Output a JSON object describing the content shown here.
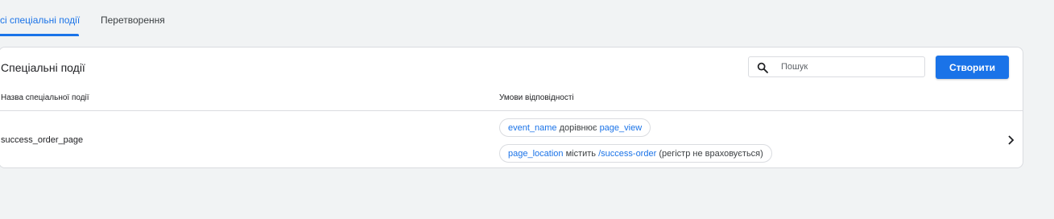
{
  "tabs": [
    {
      "label": "сі спеціальні події",
      "active": true
    },
    {
      "label": "Перетворення",
      "active": false
    }
  ],
  "card": {
    "title": "Спеціальні події",
    "search": {
      "placeholder": "Пошук",
      "icon": "search-icon"
    },
    "create_button": "Створити"
  },
  "table": {
    "columns": [
      "Назва спеціальної події",
      "Умови відповідності"
    ],
    "rows": [
      {
        "name": "success_order_page",
        "conditions": [
          {
            "param": "event_name",
            "operator": "дорівнює",
            "value": "page_view",
            "note": ""
          },
          {
            "param": "page_location",
            "operator": "містить",
            "value": "/success-order",
            "note": "(регістр не враховується)"
          }
        ],
        "action_icon": "chevron-right-icon"
      }
    ]
  },
  "colors": {
    "accent": "#1a73e8",
    "background": "#f1f3f4",
    "card": "#ffffff",
    "border": "#dadce0"
  }
}
